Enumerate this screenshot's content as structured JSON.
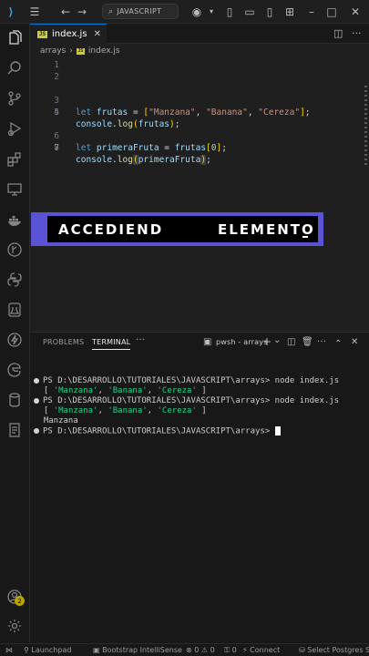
{
  "titlebar": {
    "search_text": "JAVASCRIPT"
  },
  "tabs": [
    {
      "label": "index.js",
      "close": "✕",
      "icon": "JS"
    }
  ],
  "breadcrumb": {
    "folder": "arrays",
    "sep": "›",
    "file": "index.js"
  },
  "editor": {
    "line_numbers": [
      "1",
      "2",
      "3",
      "4",
      "5",
      "6",
      "7",
      "8"
    ],
    "active_line": "7",
    "code": {
      "l3_kw": "let",
      "l3_var": "frutas",
      "l3_eq": " = ",
      "l3_open": "[",
      "l3_s1": "\"Manzana\"",
      "l3_s2": "\"Banana\"",
      "l3_s3": "\"Cereza\"",
      "l3_comma": ", ",
      "l3_close": "]",
      "l3_semi": ";",
      "l4_obj": "console",
      "l4_dot": ".",
      "l4_fn": "log",
      "l4_open": "(",
      "l4_arg": "frutas",
      "l4_close": ")",
      "l4_semi": ";",
      "l6_kw": "let",
      "l6_var": "primeraFruta",
      "l6_eq": " = ",
      "l6_arr": "frutas",
      "l6_open": "[",
      "l6_idx": "0",
      "l6_close": "]",
      "l6_semi": ";",
      "l7_obj": "console",
      "l7_dot": ".",
      "l7_fn": "log",
      "l7_open": "(",
      "l7_arg": "primeraFruta",
      "l7_close": ")",
      "l7_semi": ";"
    }
  },
  "banner": {
    "word1": "ACCEDIEND",
    "word2": "ELEMENTO"
  },
  "panel": {
    "tabs": [
      "PROBLEMS",
      "TERMINAL"
    ],
    "more": "···",
    "terminal_name": "pwsh - arrays",
    "add": "+",
    "chevron": "⌄",
    "up": "⌃",
    "close": "✕"
  },
  "terminal": {
    "prompt": "PS D:\\DESARROLLO\\TUTORIALES\\JAVASCRIPT\\arrays> ",
    "cmd": "node index.js",
    "out_open": "[ ",
    "out_close": " ]",
    "out_s1": "'Manzana'",
    "out_s2": "'Banana'",
    "out_s3": "'Cereza'",
    "out_sep": ", ",
    "out_value": "Manzana"
  },
  "statusbar": {
    "launchpad": "Launchpad",
    "bootstrap": "Bootstrap IntelliSense",
    "errors": "0",
    "warnings": "0",
    "ports": "0",
    "connect": "Connect",
    "postgres": "Select Postgres Ses"
  }
}
